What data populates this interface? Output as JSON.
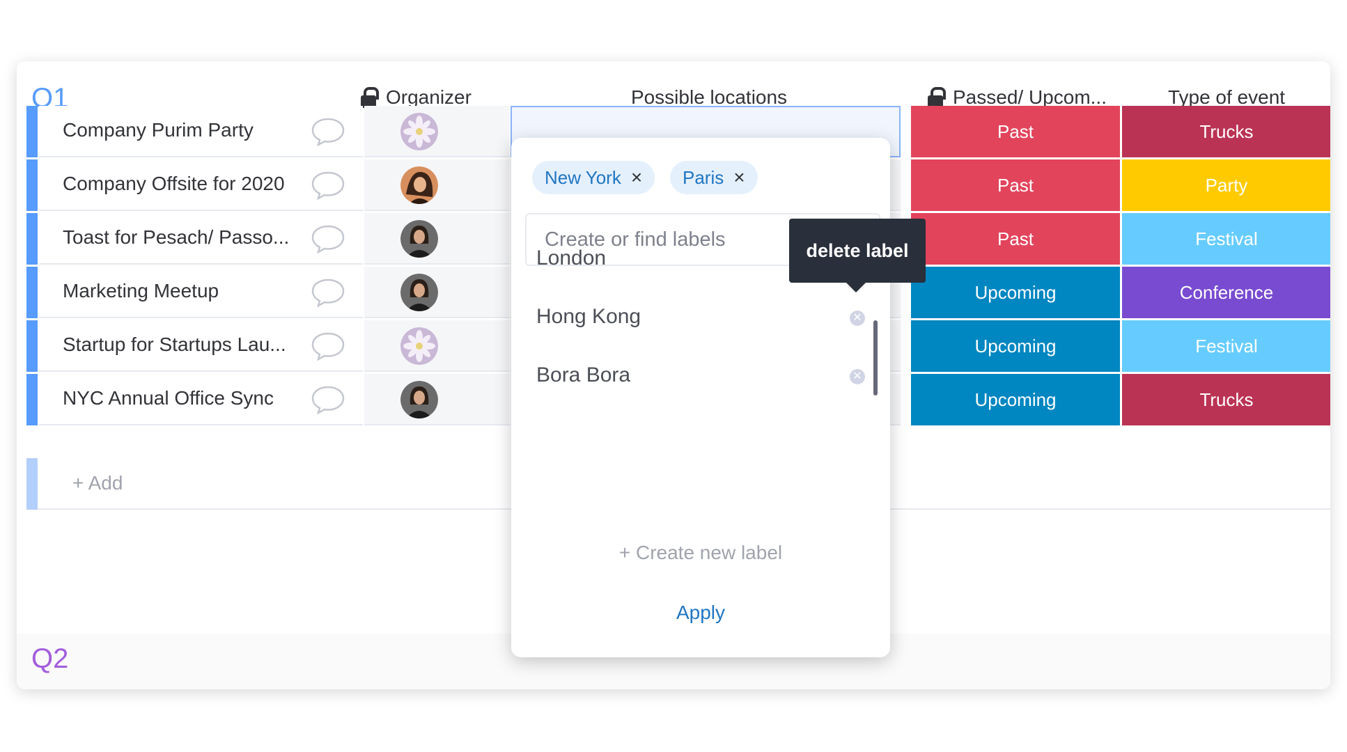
{
  "groups": {
    "q1": {
      "title": "Q1",
      "color": "#579bfc"
    },
    "q2": {
      "title": "Q2",
      "color": "#a25ddc"
    }
  },
  "columns": {
    "organizer": "Organizer",
    "locations": "Possible locations",
    "status": "Passed/ Upcom...",
    "type": "Type of event"
  },
  "rows": [
    {
      "name": "Company Purim Party",
      "avatar": "flower-avatar",
      "status": "Past",
      "status_color": "#e2445c",
      "type": "Trucks",
      "type_color": "#bb3354"
    },
    {
      "name": "Company Offsite for 2020",
      "avatar": "person-avatar-a",
      "status": "Past",
      "status_color": "#e2445c",
      "type": "Party",
      "type_color": "#ffcb00"
    },
    {
      "name": "Toast for Pesach/ Passo...",
      "avatar": "person-avatar-b",
      "status": "Past",
      "status_color": "#e2445c",
      "type": "Festival",
      "type_color": "#66ccff"
    },
    {
      "name": "Marketing Meetup",
      "avatar": "person-avatar-b",
      "status": "Upcoming",
      "status_color": "#0086c0",
      "type": "Conference",
      "type_color": "#784bd1"
    },
    {
      "name": "Startup for Startups Lau...",
      "avatar": "flower-avatar",
      "status": "Upcoming",
      "status_color": "#0086c0",
      "type": "Festival",
      "type_color": "#66ccff"
    },
    {
      "name": "NYC Annual Office Sync",
      "avatar": "person-avatar-b",
      "status": "Upcoming",
      "status_color": "#0086c0",
      "type": "Trucks",
      "type_color": "#bb3354"
    }
  ],
  "add_row": {
    "label": "+ Add"
  },
  "popup": {
    "selected_labels": [
      "New York",
      "Paris"
    ],
    "chip_remove_glyph": "×",
    "search_placeholder": "Create or find labels",
    "options": [
      "London",
      "Hong Kong",
      "Bora Bora"
    ],
    "create_new": "+ Create new label",
    "apply": "Apply"
  },
  "tooltip": {
    "text": "delete label"
  },
  "colors": {
    "accent": "#1f76c2",
    "chip_bg": "#e5f0fd",
    "past": "#e2445c",
    "upcoming": "#0086c0"
  }
}
